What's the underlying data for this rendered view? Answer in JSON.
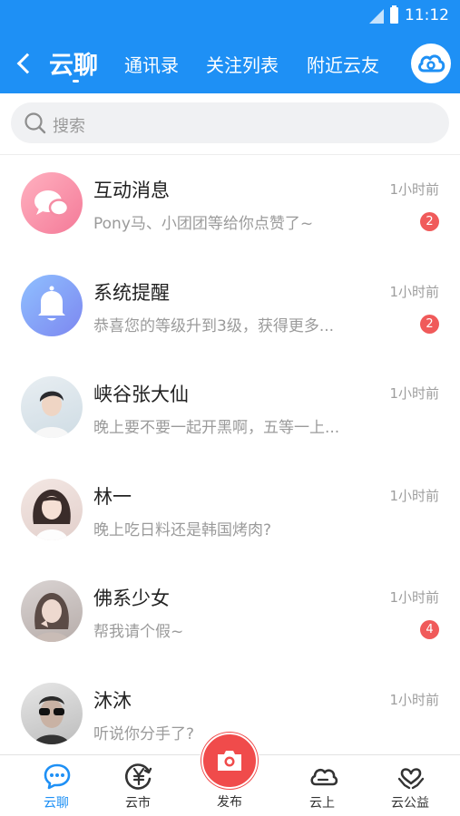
{
  "colors": {
    "brand": "#1E90F5",
    "badge": "#F05A5A",
    "publish": "#F04B4B"
  },
  "status_bar": {
    "time": "11:12"
  },
  "header": {
    "tabs": [
      {
        "label": "云聊",
        "active": true
      },
      {
        "label": "通讯录",
        "active": false
      },
      {
        "label": "关注列表",
        "active": false
      },
      {
        "label": "附近云友",
        "active": false
      }
    ],
    "back_icon": "chevron-left-icon",
    "action_icon": "cloud-icon"
  },
  "search": {
    "placeholder": "搜索",
    "icon": "search-icon"
  },
  "conversations": [
    {
      "name": "互动消息",
      "message": "Pony马、小团团等给你点赞了~",
      "time": "1小时前",
      "badge": "2"
    },
    {
      "name": "系统提醒",
      "message": "恭喜您的等级升到3级，获得更多...",
      "time": "1小时前",
      "badge": "2"
    },
    {
      "name": "峡谷张大仙",
      "message": "晚上要不要一起开黑啊，五等一上...",
      "time": "1小时前",
      "badge": ""
    },
    {
      "name": "林一",
      "message": "晚上吃日料还是韩国烤肉?",
      "time": "1小时前",
      "badge": ""
    },
    {
      "name": "佛系少女",
      "message": "帮我请个假~",
      "time": "1小时前",
      "badge": "4"
    },
    {
      "name": "沐沐",
      "message": "听说你分手了?",
      "time": "1小时前",
      "badge": ""
    }
  ],
  "tabbar": {
    "items": [
      {
        "label": "云聊",
        "icon": "chat-icon",
        "active": true
      },
      {
        "label": "云市",
        "icon": "yuan-icon",
        "active": false
      },
      {
        "label": "发布",
        "icon": "camera-icon",
        "active": false
      },
      {
        "label": "云上",
        "icon": "cloud-icon",
        "active": false
      },
      {
        "label": "云公益",
        "icon": "heart-hands-icon",
        "active": false
      }
    ]
  }
}
